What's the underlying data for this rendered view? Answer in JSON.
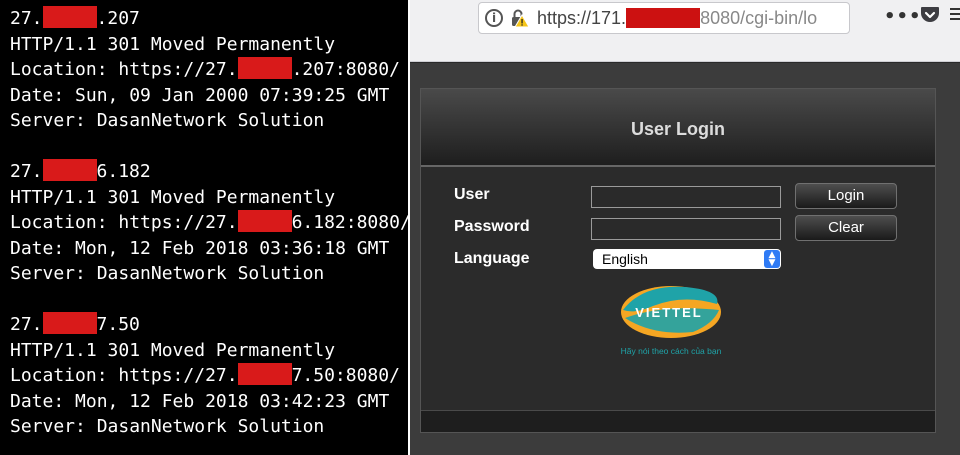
{
  "terminal": {
    "blocks": [
      {
        "ip_prefix": "27.",
        "ip_suffix": ".207",
        "status": "HTTP/1.1 301 Moved Permanently",
        "loc_prefix": "Location: https://27.",
        "loc_suffix": ".207:8080/",
        "date": "Date: Sun, 09 Jan 2000 07:39:25 GMT",
        "server": "Server: DasanNetwork Solution"
      },
      {
        "ip_prefix": "27.",
        "ip_suffix": "6.182",
        "status": "HTTP/1.1 301 Moved Permanently",
        "loc_prefix": "Location: https://27.",
        "loc_suffix": "6.182:8080/",
        "date": "Date: Mon, 12 Feb 2018 03:36:18 GMT",
        "server": "Server: DasanNetwork Solution"
      },
      {
        "ip_prefix": "27.",
        "ip_suffix": "7.50",
        "status": "HTTP/1.1 301 Moved Permanently",
        "loc_prefix": "Location: https://27.",
        "loc_suffix": "7.50:8080/",
        "date": "Date: Mon, 12 Feb 2018 03:42:23 GMT",
        "server": "Server: DasanNetwork Solution"
      }
    ]
  },
  "browser": {
    "url_prefix": "https://171.",
    "url_suffix": "8080/cgi-bin/lo",
    "icons": [
      "info-icon",
      "lock-warning-icon",
      "more-icon",
      "pocket-icon",
      "hamburger-icon"
    ],
    "more_glyph": "•••"
  },
  "login": {
    "title": "User Login",
    "user_label": "User",
    "password_label": "Password",
    "language_label": "Language",
    "language_value": "English",
    "login_button": "Login",
    "clear_button": "Clear",
    "logo_text": "VIETTEL",
    "slogan": "Hãy nói theo cách của bạn"
  },
  "colors": {
    "terminal_bg": "#000000",
    "redaction": "#d91a1a",
    "logo_teal": "#1fa3a8",
    "logo_orange": "#f5a623"
  }
}
